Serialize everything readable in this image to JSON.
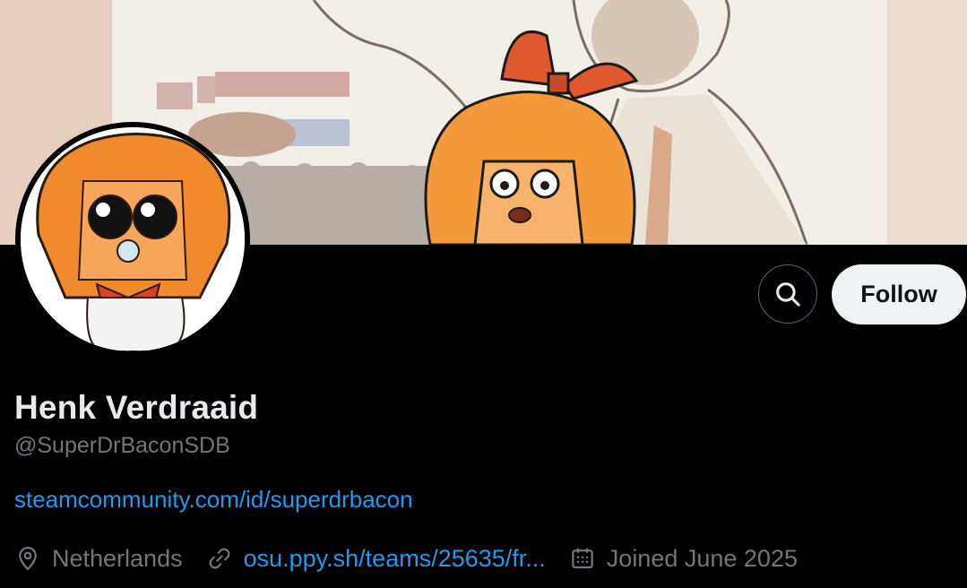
{
  "profile": {
    "display_name": "Henk Verdraaid",
    "handle": "@SuperDrBaconSDB",
    "bio_link": "steamcommunity.com/id/superdrbacon",
    "location": "Netherlands",
    "website": "osu.ppy.sh/teams/25635/fr...",
    "joined": "Joined June 2025"
  },
  "actions": {
    "search_icon": "search-icon",
    "follow_label": "Follow"
  },
  "colors": {
    "background": "#000000",
    "link": "#1d9bf0",
    "secondary_text": "#71767b",
    "follow_button_bg": "#eff3f4"
  }
}
